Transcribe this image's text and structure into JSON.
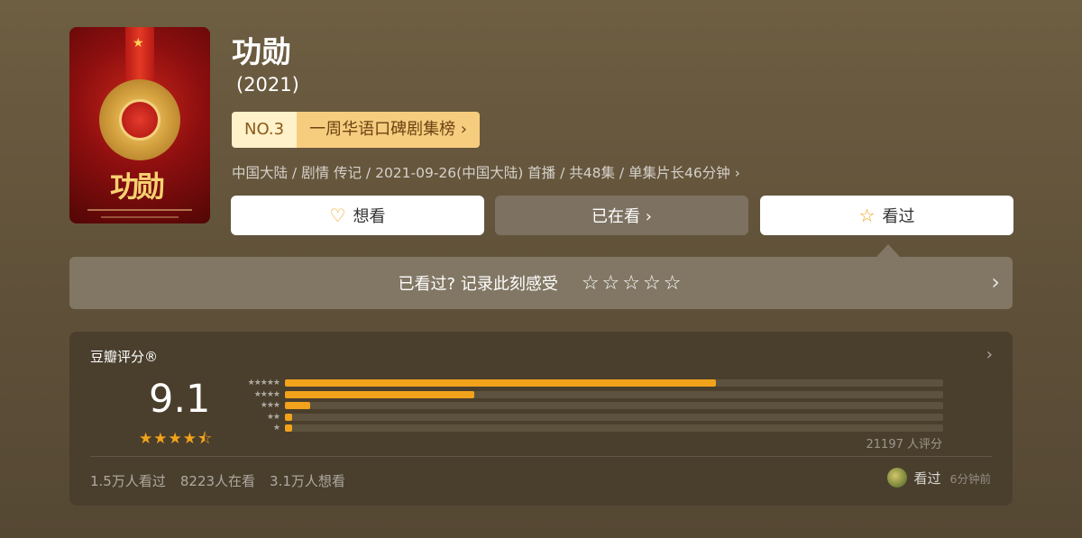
{
  "movie": {
    "title": "功勋",
    "year": "(2021)",
    "poster": {
      "title_text": "功勋"
    },
    "rank": {
      "number": "NO.3",
      "list": "一周华语口碑剧集榜 ›"
    },
    "meta": "中国大陆 / 剧情 传记 / 2021-09-26(中国大陆) 首播 / 共48集 / 单集片长46分钟 ›"
  },
  "actions": {
    "want": {
      "icon": "heart-plus-icon",
      "label": "想看"
    },
    "watching": {
      "label": "已在看 ›"
    },
    "watched": {
      "icon": "star-icon",
      "label": "看过"
    }
  },
  "rating_prompt": {
    "text": "已看过? 记录此刻感受",
    "stars": "☆☆☆☆☆",
    "arrow": "›"
  },
  "score": {
    "label": "豆瓣评分®",
    "value": "9.1",
    "stars_display": "★★★★⯪",
    "distribution": [
      {
        "label": "★★★★★",
        "percent": 65.5
      },
      {
        "label": "★★★★",
        "percent": 28.7
      },
      {
        "label": "★★★",
        "percent": 3.9
      },
      {
        "label": "★★",
        "percent": 1.1
      },
      {
        "label": "★",
        "percent": 1.1
      }
    ],
    "count_text": "21197 人评分",
    "stats": [
      "1.5万人看过",
      "8223人在看",
      "3.1万人想看"
    ],
    "footer": {
      "status": "看过",
      "time": "6分钟前"
    }
  },
  "colors": {
    "accent": "#f2a21b",
    "rank_bg": "#f6cd7f",
    "card_bg": "#4a3f2d"
  }
}
